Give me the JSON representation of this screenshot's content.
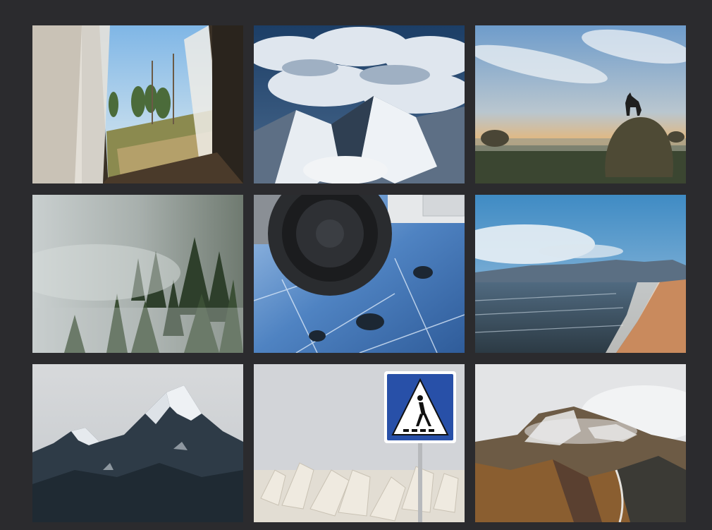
{
  "gallery": {
    "items": [
      {
        "name": "train-window-photo"
      },
      {
        "name": "clouds-over-mountains-photo"
      },
      {
        "name": "dog-on-haybale-at-dawn-photo"
      },
      {
        "name": "misty-forest-photo"
      },
      {
        "name": "tire-on-ice-photo"
      },
      {
        "name": "lake-shore-beach-photo"
      },
      {
        "name": "snowy-peaks-photo"
      },
      {
        "name": "pedestrian-crossing-sign-photo"
      },
      {
        "name": "volcanic-hills-photo"
      }
    ]
  }
}
